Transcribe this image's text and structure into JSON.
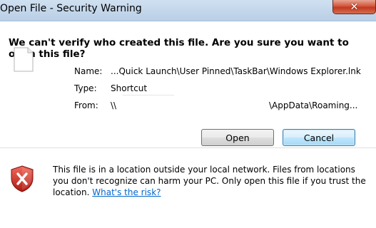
{
  "window": {
    "title": "Open File - Security Warning",
    "close_glyph": "✕"
  },
  "dialog": {
    "heading": "We can't verify who created this file. Are you sure you want to open this file?",
    "fields": {
      "name_label": "Name:",
      "name_value": "...Quick Launch\\User Pinned\\TaskBar\\Windows Explorer.lnk",
      "type_label": "Type:",
      "type_value": "Shortcut",
      "from_label": "From:",
      "from_value_left": "\\\\",
      "from_value_right": "\\AppData\\Roaming..."
    },
    "buttons": {
      "open": "Open",
      "cancel": "Cancel"
    },
    "warning": {
      "text": "This file is in a location outside your local network. Files from locations you don't recognize can harm your PC. Only open this file if you trust the location.",
      "link": "What's the risk?"
    }
  },
  "icons": {
    "file": "file-icon",
    "shield": "shield-warning-icon",
    "close": "close-icon"
  },
  "colors": {
    "link": "#0066cc",
    "shield_red": "#c8241c",
    "titlebar": "#c9dcef"
  }
}
